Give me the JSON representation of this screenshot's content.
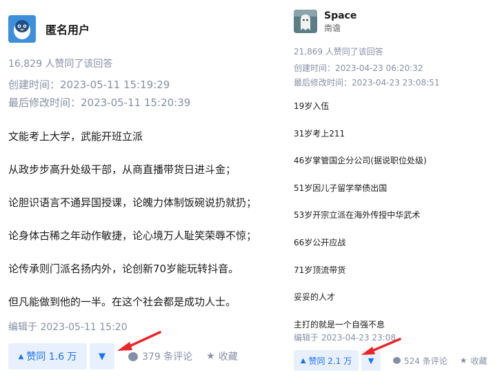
{
  "left": {
    "author": {
      "name": "匿名用户",
      "avatar_icon": "penguin-anonymous-icon"
    },
    "likes_text": "16,829 人赞同了该回答",
    "created": "创建时间：2023-05-11 15:19:29",
    "modified": "最后修改时间：2023-05-11 15:20:39",
    "paragraphs": [
      "文能考上大学，武能开班立派",
      "从政步步高升处级干部，从商直播带货日进斗金；",
      "论胆识语言不通异国授课，论魄力体制饭碗说扔就扔；",
      "论身体古稀之年动作敏捷，论心境万人耻笑荣辱不惊；",
      "论传承则门派名扬内外，论创新70岁能玩转抖音。",
      "但凡能做到他的一半。在这个社会都是成功人士。"
    ],
    "edited": "编辑于 2023-05-11 15:20",
    "vote_up_label": "赞同 1.6 万",
    "comment_label": "379 条评论",
    "favorite_label": "收藏"
  },
  "right": {
    "author": {
      "name": "Space",
      "subtitle": "南谵",
      "avatar_icon": "ghost-avatar-icon"
    },
    "likes_text": "21,869 人赞同了该回答",
    "created": "创建时间：2023-04-23 06:20:32",
    "modified": "最后修改时间：2023-04-23 23:08:51",
    "paragraphs": [
      "19岁入伍",
      "31岁考上211",
      "46岁掌管国企分公司(据说职位处级)",
      "51岁因儿子留学举债出国",
      "53岁开宗立派在海外传授中华武术",
      "66岁公开应战",
      "71岁顶流带货",
      "妥妥的人才",
      "主打的就是一个自强不息"
    ],
    "edited": "编辑于 2023-04-23 23:08",
    "vote_up_label": "赞同 2.1 万",
    "comment_label": "524 条评论",
    "favorite_label": "收藏"
  },
  "colors": {
    "accent": "#1772f6",
    "vote_bg": "#e9f0fd",
    "meta_gray": "#8590a6",
    "arrow_red": "#e8262a"
  }
}
